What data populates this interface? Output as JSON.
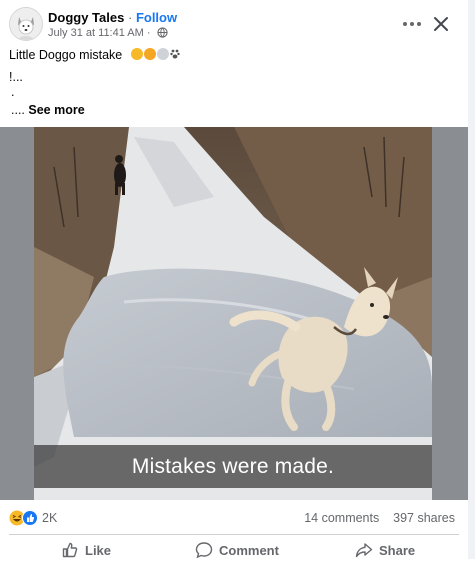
{
  "header": {
    "page_name": "Doggy Tales",
    "separator": "·",
    "follow_label": "Follow",
    "timestamp": "July 31 at 11:41 AM",
    "meta_separator": "·"
  },
  "caption": {
    "line1": "Little Doggo mistake",
    "line2": "!...",
    "line3": ".",
    "see_more_prefix": "....",
    "see_more_label": "See more"
  },
  "media": {
    "subtitle": "Mistakes were made."
  },
  "reactions": {
    "count": "2K",
    "comments": "14 comments",
    "shares": "397 shares"
  },
  "actions": {
    "like": "Like",
    "comment": "Comment",
    "share": "Share"
  },
  "colors": {
    "link": "#1877f2",
    "muted": "#65676b",
    "haha": "#f7b928",
    "like": "#1877f2"
  }
}
